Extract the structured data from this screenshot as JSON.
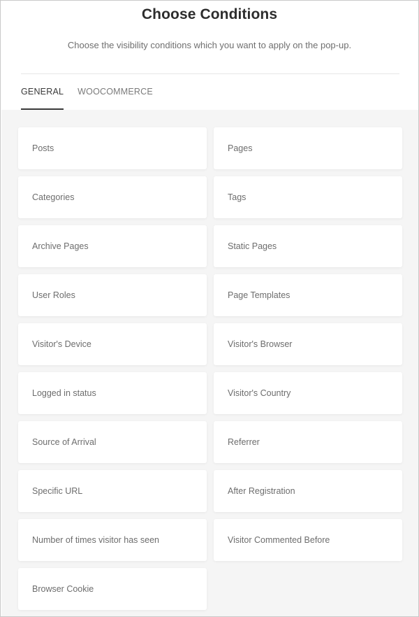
{
  "header": {
    "title": "Choose Conditions",
    "subtitle": "Choose the visibility conditions which you want to apply on the pop-up."
  },
  "tabs": [
    {
      "label": "GENERAL",
      "active": true
    },
    {
      "label": "WOOCOMMERCE",
      "active": false
    }
  ],
  "conditions": [
    "Posts",
    "Pages",
    "Categories",
    "Tags",
    "Archive Pages",
    "Static Pages",
    "User Roles",
    "Page Templates",
    "Visitor's Device",
    "Visitor's Browser",
    "Logged in status",
    "Visitor's Country",
    "Source of Arrival",
    "Referrer",
    "Specific URL",
    "After Registration",
    "Number of times visitor has seen",
    "Visitor Commented Before",
    "Browser Cookie"
  ]
}
